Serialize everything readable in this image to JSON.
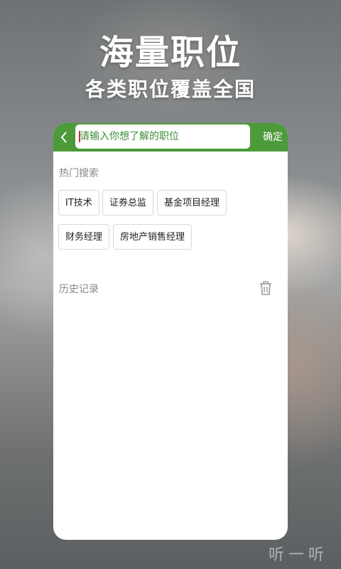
{
  "hero": {
    "title": "海量职位",
    "subtitle": "各类职位覆盖全国"
  },
  "search": {
    "placeholder": "请输入你想了解的职位",
    "confirm_label": "确定",
    "back_icon": "chevron-left-icon"
  },
  "hot_search": {
    "label": "热门搜索",
    "tags": [
      "IT技术",
      "证券总监",
      "基金项目经理",
      "财务经理",
      "房地产销售经理"
    ]
  },
  "history": {
    "label": "历史记录",
    "clear_icon": "trash-icon"
  },
  "watermark": "听一听",
  "colors": {
    "accent": "#4c9a3a",
    "text_green": "#3d8f36"
  }
}
